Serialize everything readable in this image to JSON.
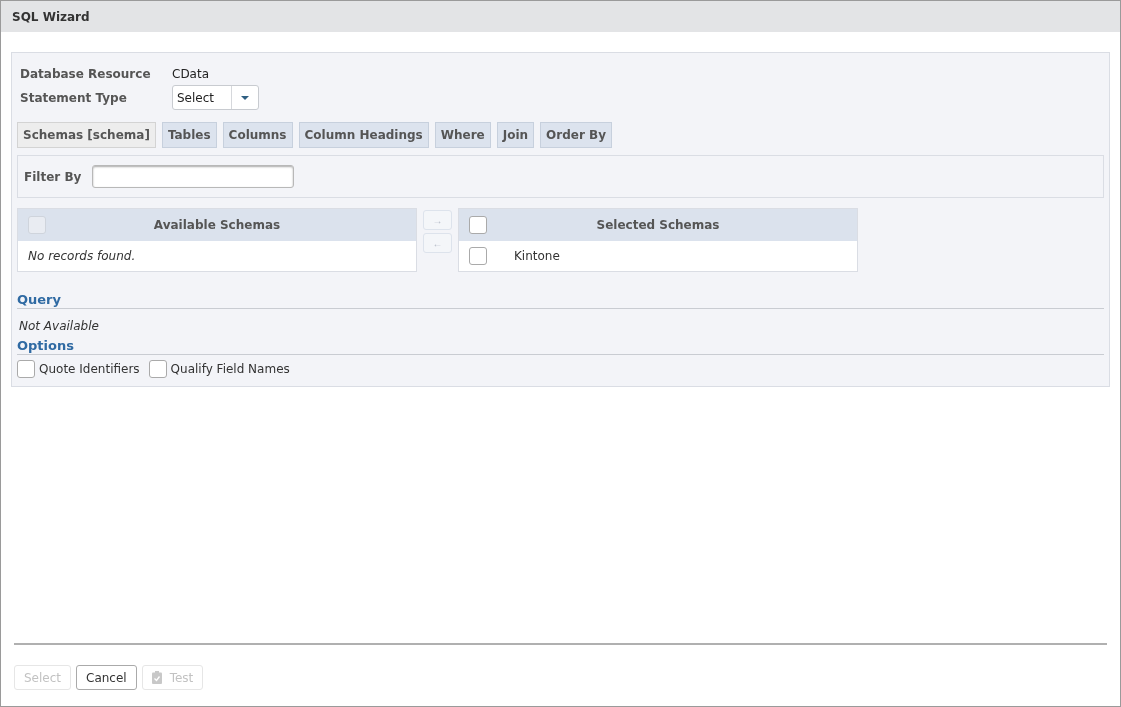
{
  "window": {
    "title": "SQL Wizard"
  },
  "resource": {
    "label": "Database Resource",
    "value": "CData"
  },
  "statement_type": {
    "label": "Statement Type",
    "value": "Select"
  },
  "tabs": [
    {
      "label": "Schemas [schema]",
      "selected": true
    },
    {
      "label": "Tables",
      "selected": false
    },
    {
      "label": "Columns",
      "selected": false
    },
    {
      "label": "Column Headings",
      "selected": false
    },
    {
      "label": "Where",
      "selected": false
    },
    {
      "label": "Join",
      "selected": false
    },
    {
      "label": "Order By",
      "selected": false
    }
  ],
  "filter": {
    "label": "Filter By"
  },
  "available": {
    "title": "Available Schemas",
    "header_checkbox": {
      "checked": false,
      "disabled": true
    },
    "empty_text": "No records found."
  },
  "move_buttons": [
    {
      "label": "→",
      "disabled": true
    },
    {
      "label": "←",
      "disabled": true
    }
  ],
  "selected": {
    "title": "Selected Schemas",
    "header_checkbox": {
      "checked": false,
      "disabled": false
    },
    "rows": [
      {
        "name": "Kintone",
        "checked": false
      }
    ]
  },
  "query": {
    "heading": "Query",
    "text": "Not Available"
  },
  "options": {
    "heading": "Options",
    "items": [
      {
        "label": "Quote Identifiers",
        "checked": false
      },
      {
        "label": "Qualify Field Names",
        "checked": false
      }
    ]
  },
  "buttons": [
    {
      "label": "Select",
      "disabled": true,
      "has_icon": false
    },
    {
      "label": "Cancel",
      "disabled": false,
      "has_icon": false
    },
    {
      "label": "Test",
      "disabled": true,
      "has_icon": true
    }
  ]
}
